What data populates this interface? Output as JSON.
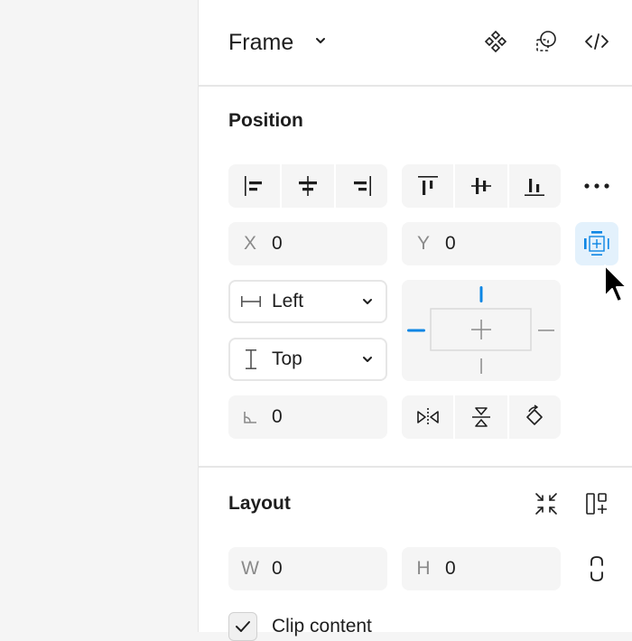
{
  "header": {
    "title": "Frame",
    "actions": [
      {
        "icon": "component-icon"
      },
      {
        "icon": "mask-icon"
      },
      {
        "icon": "code-icon"
      }
    ]
  },
  "position": {
    "title": "Position",
    "align_icons": [
      "align-left-icon",
      "align-horizontal-center-icon",
      "align-right-icon",
      "align-top-icon",
      "align-vertical-center-icon",
      "align-bottom-icon"
    ],
    "more_icon": "more-icon",
    "x": {
      "label": "X",
      "value": "0"
    },
    "y": {
      "label": "Y",
      "value": "0"
    },
    "horizontal_constraint": "Left",
    "vertical_constraint": "Top",
    "rotation": {
      "value": "0"
    },
    "accent_color": "#0d86e4"
  },
  "layout": {
    "title": "Layout",
    "w": {
      "label": "W",
      "value": "0"
    },
    "h": {
      "label": "H",
      "value": "0"
    },
    "clip_content": {
      "label": "Clip content",
      "checked": true
    }
  }
}
